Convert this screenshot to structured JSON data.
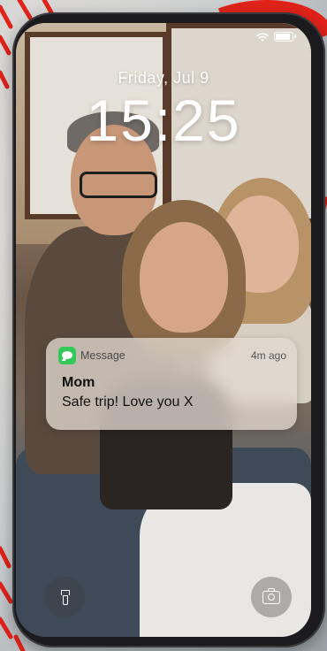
{
  "lockscreen": {
    "date": "Friday, Jul 9",
    "time": "15:25"
  },
  "notification": {
    "app_icon": "message-icon",
    "app_name": "Message",
    "time_ago": "4m ago",
    "sender": "Mom",
    "body": "Safe trip! Love you X"
  },
  "icons": {
    "wifi": "wifi-icon",
    "battery": "battery-icon",
    "flashlight": "flashlight-icon",
    "camera": "camera-icon"
  },
  "colors": {
    "brand_red": "#e2231a",
    "message_green": "#34c759"
  }
}
